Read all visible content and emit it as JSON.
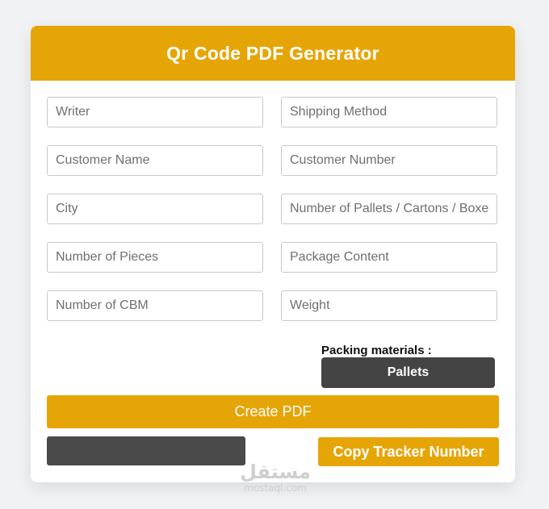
{
  "header": {
    "title": "Qr Code PDF Generator"
  },
  "form": {
    "writer": {
      "placeholder": "Writer",
      "value": ""
    },
    "shipping_method": {
      "placeholder": "Shipping Method",
      "value": ""
    },
    "customer_name": {
      "placeholder": "Customer Name",
      "value": ""
    },
    "customer_number": {
      "placeholder": "Customer Number",
      "value": ""
    },
    "city": {
      "placeholder": "City",
      "value": ""
    },
    "pallets_cartons_boxes": {
      "placeholder": "Number of Pallets / Cartons / Boxes",
      "value": ""
    },
    "pieces": {
      "placeholder": "Number of Pieces",
      "value": ""
    },
    "package_content": {
      "placeholder": "Package Content",
      "value": ""
    },
    "cbm": {
      "placeholder": "Number of CBM",
      "value": ""
    },
    "weight": {
      "placeholder": "Weight",
      "value": ""
    }
  },
  "packing": {
    "label": "Packing materials :",
    "selected": "Pallets"
  },
  "actions": {
    "create_pdf": "Create PDF",
    "copy_tracker": "Copy Tracker Number",
    "tracker_value": ""
  },
  "watermark": {
    "logo": "مستقل",
    "text": "mostaql.com"
  },
  "colors": {
    "accent": "#e6a507",
    "dark": "#444444",
    "background": "#f1f2f4"
  }
}
